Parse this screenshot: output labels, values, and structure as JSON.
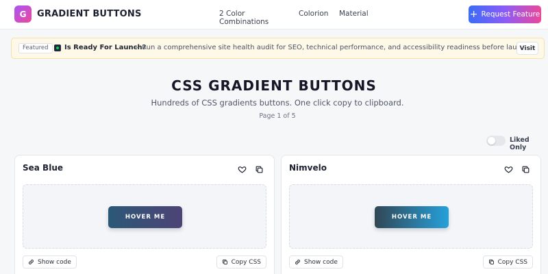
{
  "header": {
    "logo_letter": "G",
    "logo_text": "GRADIENT BUTTONS",
    "nav": [
      "2 Color Combinations",
      "Colorion",
      "Material"
    ],
    "request_label": "Request Feature"
  },
  "banner": {
    "tag": "Featured",
    "title": "Is Ready For Launch?",
    "text": "— Run a comprehensive site health audit for SEO, technical performance, and accessibility readiness before launch.",
    "visit_label": "Visit"
  },
  "hero": {
    "title": "CSS GRADIENT BUTTONS",
    "subtitle": "Hundreds of CSS gradients buttons. One click copy to clipboard.",
    "page": "Page 1 of 5"
  },
  "filter": {
    "liked_only_label": "Liked Only",
    "liked_only_on": false
  },
  "cards": [
    {
      "title": "Sea Blue",
      "button_label": "HOVER ME",
      "gradient": [
        "#2b5876",
        "#4e4376"
      ],
      "show_code_label": "Show code",
      "copy_css_label": "Copy CSS"
    },
    {
      "title": "Nimvelo",
      "button_label": "HOVER ME",
      "gradient": [
        "#314755",
        "#26a0da"
      ],
      "show_code_label": "Show code",
      "copy_css_label": "Copy CSS"
    }
  ],
  "colors": {
    "accent_gradient": [
      "#3b6cf6",
      "#8b5cf6",
      "#ec4899"
    ],
    "banner_bg": "#fdf8e7"
  }
}
